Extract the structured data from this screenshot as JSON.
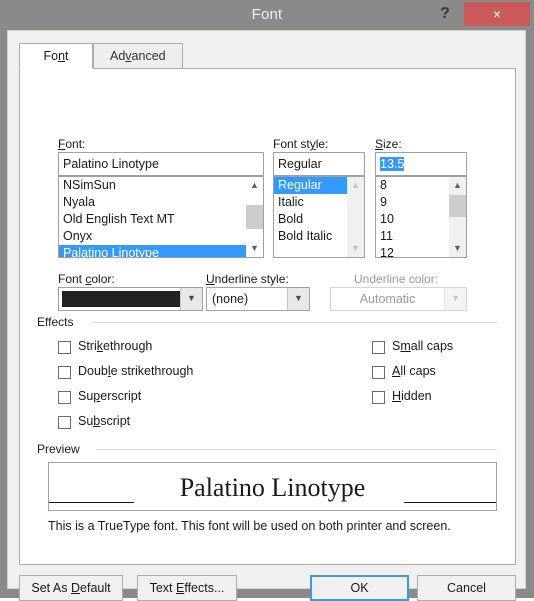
{
  "window": {
    "title": "Font",
    "help_label": "?",
    "close_label": "×"
  },
  "tabs": [
    {
      "label": "Font",
      "mnemonic": "n",
      "active": true
    },
    {
      "label": "Advanced",
      "mnemonic": "v",
      "active": false
    }
  ],
  "font_section": {
    "font_label": "Font:",
    "font_label_mnemonic": "F",
    "font_value": "Palatino Linotype",
    "font_list": [
      "NSimSun",
      "Nyala",
      "Old English Text MT",
      "Onyx",
      "Palatino Linotype"
    ],
    "font_selected": "Palatino Linotype",
    "style_label": "Font style:",
    "style_label_mnemonic": "y",
    "style_value": "Regular",
    "style_list": [
      "Regular",
      "Italic",
      "Bold",
      "Bold Italic"
    ],
    "style_selected": "Regular",
    "size_label": "Size:",
    "size_label_mnemonic": "S",
    "size_value": "13.5",
    "size_list": [
      "8",
      "9",
      "10",
      "11",
      "12"
    ],
    "size_selected": ""
  },
  "color_row": {
    "font_color_label": "Font color:",
    "font_color_mnemonic": "c",
    "font_color_value": "#212121",
    "underline_style_label": "Underline style:",
    "underline_style_mnemonic": "U",
    "underline_style_value": "(none)",
    "underline_color_label": "Underline color:",
    "underline_color_value": "Automatic",
    "underline_color_disabled": true
  },
  "effects": {
    "group_label": "Effects",
    "left_column": [
      {
        "label": "Strikethrough",
        "mnemonic": "k",
        "checked": false
      },
      {
        "label": "Double strikethrough",
        "mnemonic": "l",
        "checked": false
      },
      {
        "label": "Superscript",
        "mnemonic": "p",
        "checked": false
      },
      {
        "label": "Subscript",
        "mnemonic": "b",
        "checked": false
      }
    ],
    "right_column": [
      {
        "label": "Small caps",
        "mnemonic": "m",
        "checked": false
      },
      {
        "label": "All caps",
        "mnemonic": "A",
        "checked": false
      },
      {
        "label": "Hidden",
        "mnemonic": "H",
        "checked": false
      }
    ]
  },
  "preview": {
    "group_label": "Preview",
    "sample_text": "Palatino Linotype",
    "note": "This is a TrueType font. This font will be used on both printer and screen."
  },
  "buttons": {
    "set_as_default": "Set As Default",
    "set_as_default_mnemonic": "D",
    "text_effects": "Text Effects...",
    "text_effects_mnemonic": "E",
    "ok": "OK",
    "cancel": "Cancel"
  },
  "colors": {
    "selection_blue": "#3399ff",
    "titlebar_gray": "#8a8a8a",
    "close_red": "#cc5a5a",
    "dialog_gray": "#f0f0f0",
    "focus_blue": "#3d9ae2"
  }
}
